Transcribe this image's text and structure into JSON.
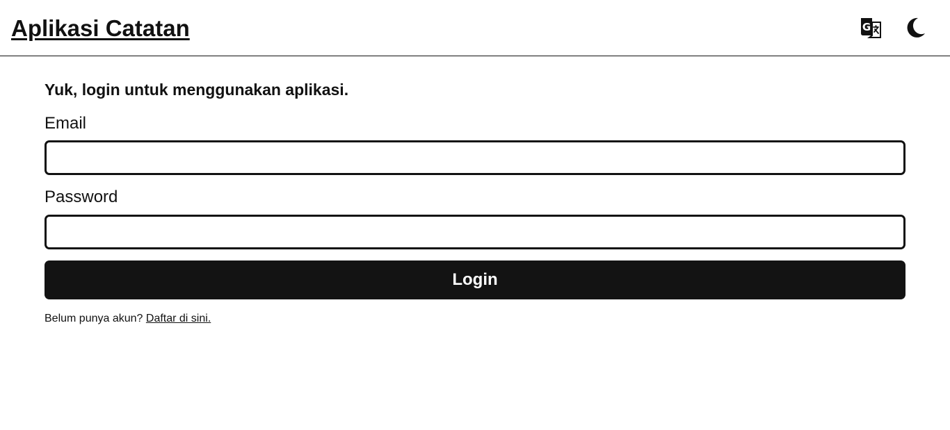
{
  "header": {
    "title": "Aplikasi Catatan",
    "translate_icon": "translate-icon",
    "theme_icon": "moon-icon"
  },
  "login": {
    "intro": "Yuk, login untuk menggunakan aplikasi.",
    "email_label": "Email",
    "email_value": "",
    "password_label": "Password",
    "password_value": "",
    "button_label": "Login",
    "register_prompt": "Belum punya akun?",
    "register_link": "Daftar di sini."
  },
  "colors": {
    "text": "#111111",
    "background": "#ffffff",
    "button": "#131313",
    "button_text": "#ffffff"
  }
}
